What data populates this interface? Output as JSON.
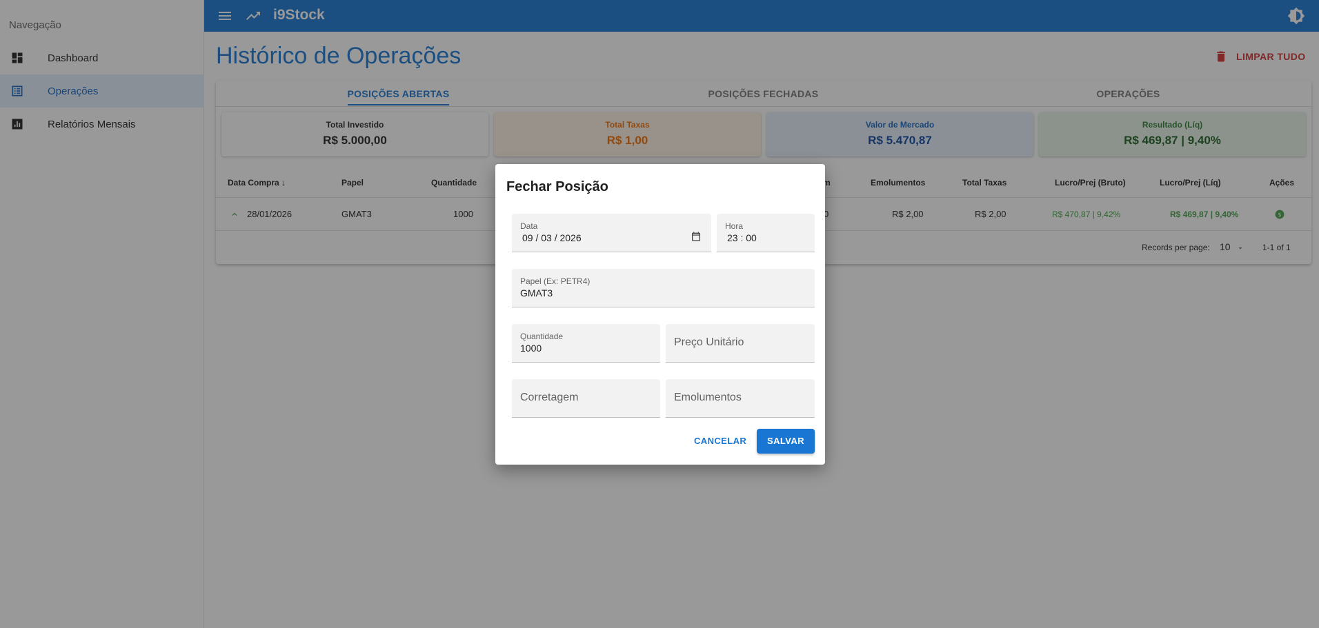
{
  "sidebar": {
    "title": "Navegação",
    "items": [
      {
        "label": "Dashboard",
        "icon": "dashboard-icon"
      },
      {
        "label": "Operações",
        "icon": "list-icon",
        "active": true
      },
      {
        "label": "Relatórios Mensais",
        "icon": "bar-chart-icon"
      }
    ]
  },
  "appbar": {
    "title": "i9Stock",
    "color": "#1976d2"
  },
  "page": {
    "title": "Histórico de Operações",
    "clear_all": "LIMPAR TUDO"
  },
  "tabs": [
    "POSIÇÕES ABERTAS",
    "POSIÇÕES FECHADAS",
    "OPERAÇÕES"
  ],
  "summary": [
    {
      "label": "Total Investido",
      "value": "R$ 5.000,00"
    },
    {
      "label": "Total Taxas",
      "value": "R$ 1,00"
    },
    {
      "label": "Valor de Mercado",
      "value": "R$ 5.470,87"
    },
    {
      "label": "Resultado (Líq)",
      "value": "R$ 469,87 | 9,40%"
    }
  ],
  "table": {
    "headers": [
      "Data Compra",
      "Papel",
      "Quantidade",
      "m",
      "Emolumentos",
      "Total Taxas",
      "Lucro/Prej (Bruto)",
      "Lucro/Prej (Líq)",
      "Ações"
    ],
    "row": {
      "date": "28/01/2026",
      "ticker": "GMAT3",
      "quantity": "1000",
      "partial": "0",
      "emolumentos": "R$ 2,00",
      "total_taxas": "R$ 2,00",
      "lucro_bruto": "R$ 470,87 | 9,42%",
      "lucro_liq": "R$ 469,87 | 9,40%"
    },
    "footer": {
      "records_label": "Records per page:",
      "per_page": "10",
      "range": "1-1 of 1"
    }
  },
  "dialog": {
    "title": "Fechar Posição",
    "date_label": "Data",
    "date_value": "09 / 03 / 2026",
    "time_label": "Hora",
    "time_value": "23 : 00",
    "ticker_label": "Papel (Ex: PETR4)",
    "ticker_value": "GMAT3",
    "quantity_label": "Quantidade",
    "quantity_value": "1000",
    "unit_price_placeholder": "Preço Unitário",
    "brokerage_placeholder": "Corretagem",
    "fees_placeholder": "Emolumentos",
    "cancel": "CANCELAR",
    "save": "SALVAR"
  }
}
